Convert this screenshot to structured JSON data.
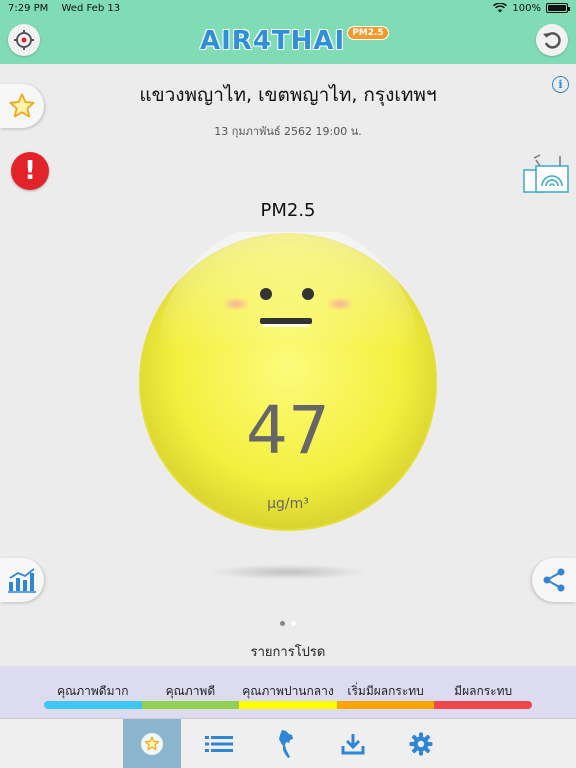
{
  "status_bar": {
    "time": "7:29 PM",
    "date": "Wed Feb 13",
    "battery": "100%",
    "battery_level": 1.0
  },
  "header": {
    "logo_text": "AIR4THAI",
    "logo_badge": "PM2.5",
    "left_icon": "crosshair-icon",
    "right_icon": "refresh-icon"
  },
  "location": {
    "name": "แขวงพญาไท, เขตพญาไท, กรุงเทพฯ",
    "datetime": "13 กุมภาพันธ์ 2562 19:00 น."
  },
  "reading": {
    "pollutant": "PM2.5",
    "value": "47",
    "unit": "μg/m³",
    "face_color": "#f5f24a"
  },
  "alert_symbol": "!",
  "info_symbol": "i",
  "pager": {
    "count": 2,
    "active": 0
  },
  "favorites_label": "รายการโปรด",
  "legend": {
    "labels": [
      "คุณภาพดีมาก",
      "คุณภาพดี",
      "คุณภาพปานกลาง",
      "เริ่มมีผลกระทบ",
      "มีผลกระทบ"
    ],
    "colors": [
      "#3bc8f2",
      "#92d050",
      "#ffff00",
      "#ffa500",
      "#f0474c"
    ]
  },
  "tabs": [
    "favorites-star-icon",
    "list-icon",
    "thailand-map-icon",
    "download-icon",
    "gear-icon"
  ],
  "colors": {
    "header_bg": "#7fdcb4",
    "accent_blue": "#2f86d6",
    "active_tab": "#8ab5cd",
    "alert_red": "#e2242a"
  }
}
